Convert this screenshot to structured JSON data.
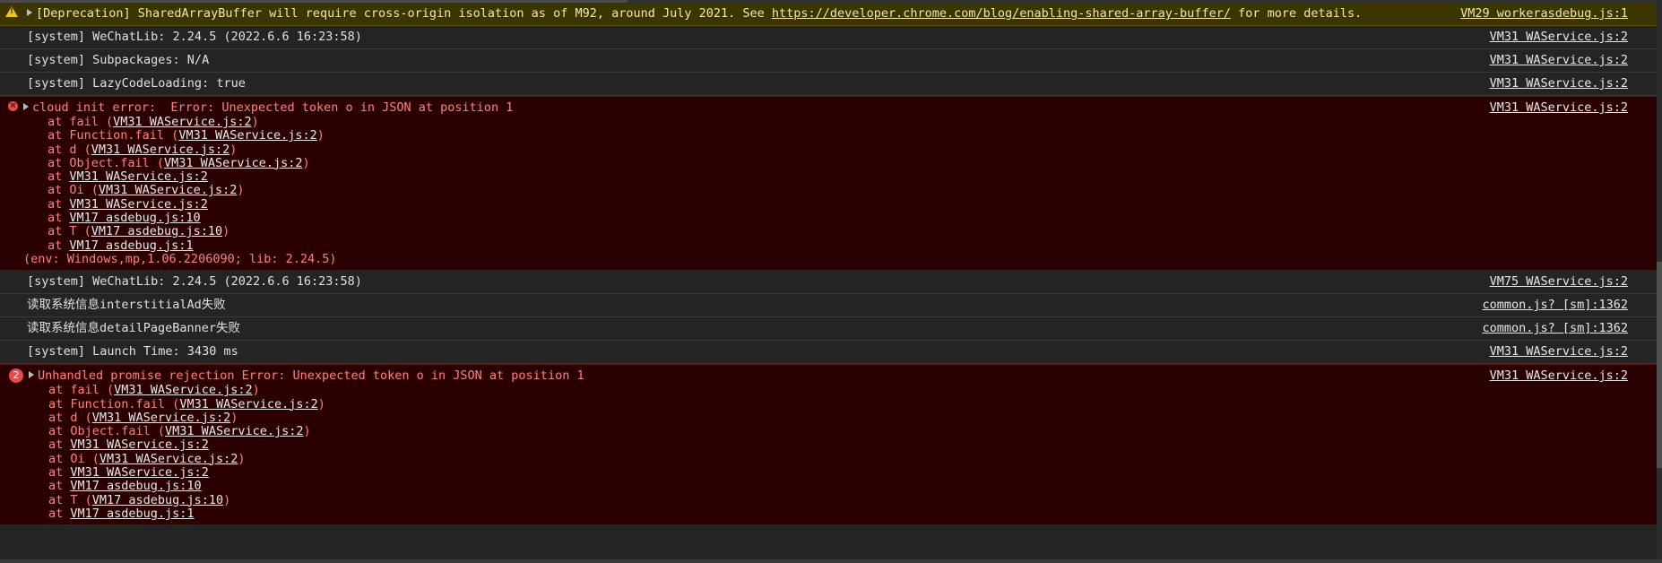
{
  "warning": {
    "text_before": "[Deprecation] SharedArrayBuffer will require cross-origin isolation as of M92, around July 2021. See ",
    "link": "https://developer.chrome.com/blog/enabling-shared-array-buffer/",
    "text_after": " for more details.",
    "source": "VM29 workerasdebug.js:1"
  },
  "rows_a": [
    {
      "text": "[system] WeChatLib: 2.24.5 (2022.6.6 16:23:58)",
      "source": "VM31 WAService.js:2"
    },
    {
      "text": "[system] Subpackages: N/A",
      "source": "VM31 WAService.js:2"
    },
    {
      "text": "[system] LazyCodeLoading: true",
      "source": "VM31 WAService.js:2"
    }
  ],
  "error1": {
    "head": "cloud init error:  Error: Unexpected token o in JSON at position 1",
    "source": "VM31 WAService.js:2",
    "stack": [
      {
        "pre": "at fail (",
        "link": "VM31 WAService.js:2",
        "post": ")"
      },
      {
        "pre": "at Function.fail (",
        "link": "VM31 WAService.js:2",
        "post": ")"
      },
      {
        "pre": "at d (",
        "link": "VM31 WAService.js:2",
        "post": ")"
      },
      {
        "pre": "at Object.fail (",
        "link": "VM31 WAService.js:2",
        "post": ")"
      },
      {
        "pre": "at ",
        "link": "VM31 WAService.js:2",
        "post": ""
      },
      {
        "pre": "at Oi (",
        "link": "VM31 WAService.js:2",
        "post": ")"
      },
      {
        "pre": "at ",
        "link": "VM31 WAService.js:2",
        "post": ""
      },
      {
        "pre": "at ",
        "link": "VM17 asdebug.js:10",
        "post": ""
      },
      {
        "pre": "at T (",
        "link": "VM17 asdebug.js:10",
        "post": ")"
      },
      {
        "pre": "at ",
        "link": "VM17 asdebug.js:1",
        "post": ""
      }
    ],
    "env": "(env: Windows,mp,1.06.2206090; lib: 2.24.5)"
  },
  "rows_b": [
    {
      "text": "[system] WeChatLib: 2.24.5 (2022.6.6 16:23:58)",
      "source": "VM75 WAService.js:2"
    },
    {
      "text": "读取系统信息interstitialAd失败",
      "source": "common.js? [sm]:1362"
    },
    {
      "text": "读取系统信息detailPageBanner失败",
      "source": "common.js? [sm]:1362"
    },
    {
      "text": "[system] Launch Time: 3430 ms",
      "source": "VM31 WAService.js:2"
    }
  ],
  "error2": {
    "count": "2",
    "head": "Unhandled promise rejection Error: Unexpected token o in JSON at position 1",
    "source": "VM31 WAService.js:2",
    "stack": [
      {
        "pre": "at fail (",
        "link": "VM31 WAService.js:2",
        "post": ")"
      },
      {
        "pre": "at Function.fail (",
        "link": "VM31 WAService.js:2",
        "post": ")"
      },
      {
        "pre": "at d (",
        "link": "VM31 WAService.js:2",
        "post": ")"
      },
      {
        "pre": "at Object.fail (",
        "link": "VM31 WAService.js:2",
        "post": ")"
      },
      {
        "pre": "at ",
        "link": "VM31 WAService.js:2",
        "post": ""
      },
      {
        "pre": "at Oi (",
        "link": "VM31 WAService.js:2",
        "post": ")"
      },
      {
        "pre": "at ",
        "link": "VM31 WAService.js:2",
        "post": ""
      },
      {
        "pre": "at ",
        "link": "VM17 asdebug.js:10",
        "post": ""
      },
      {
        "pre": "at T (",
        "link": "VM17 asdebug.js:10",
        "post": ")"
      },
      {
        "pre": "at ",
        "link": "VM17 asdebug.js:1",
        "post": ""
      }
    ]
  },
  "colors": {
    "warning_bg": "#3b3600",
    "error_bg": "#2a0000",
    "error_text": "#ff8080",
    "warn_icon": "#f3c21b",
    "badge": "#e84b4b"
  },
  "icons": {
    "warning": "warning-triangle-icon",
    "error": "error-circle-icon",
    "expand": "expand-caret-icon"
  }
}
